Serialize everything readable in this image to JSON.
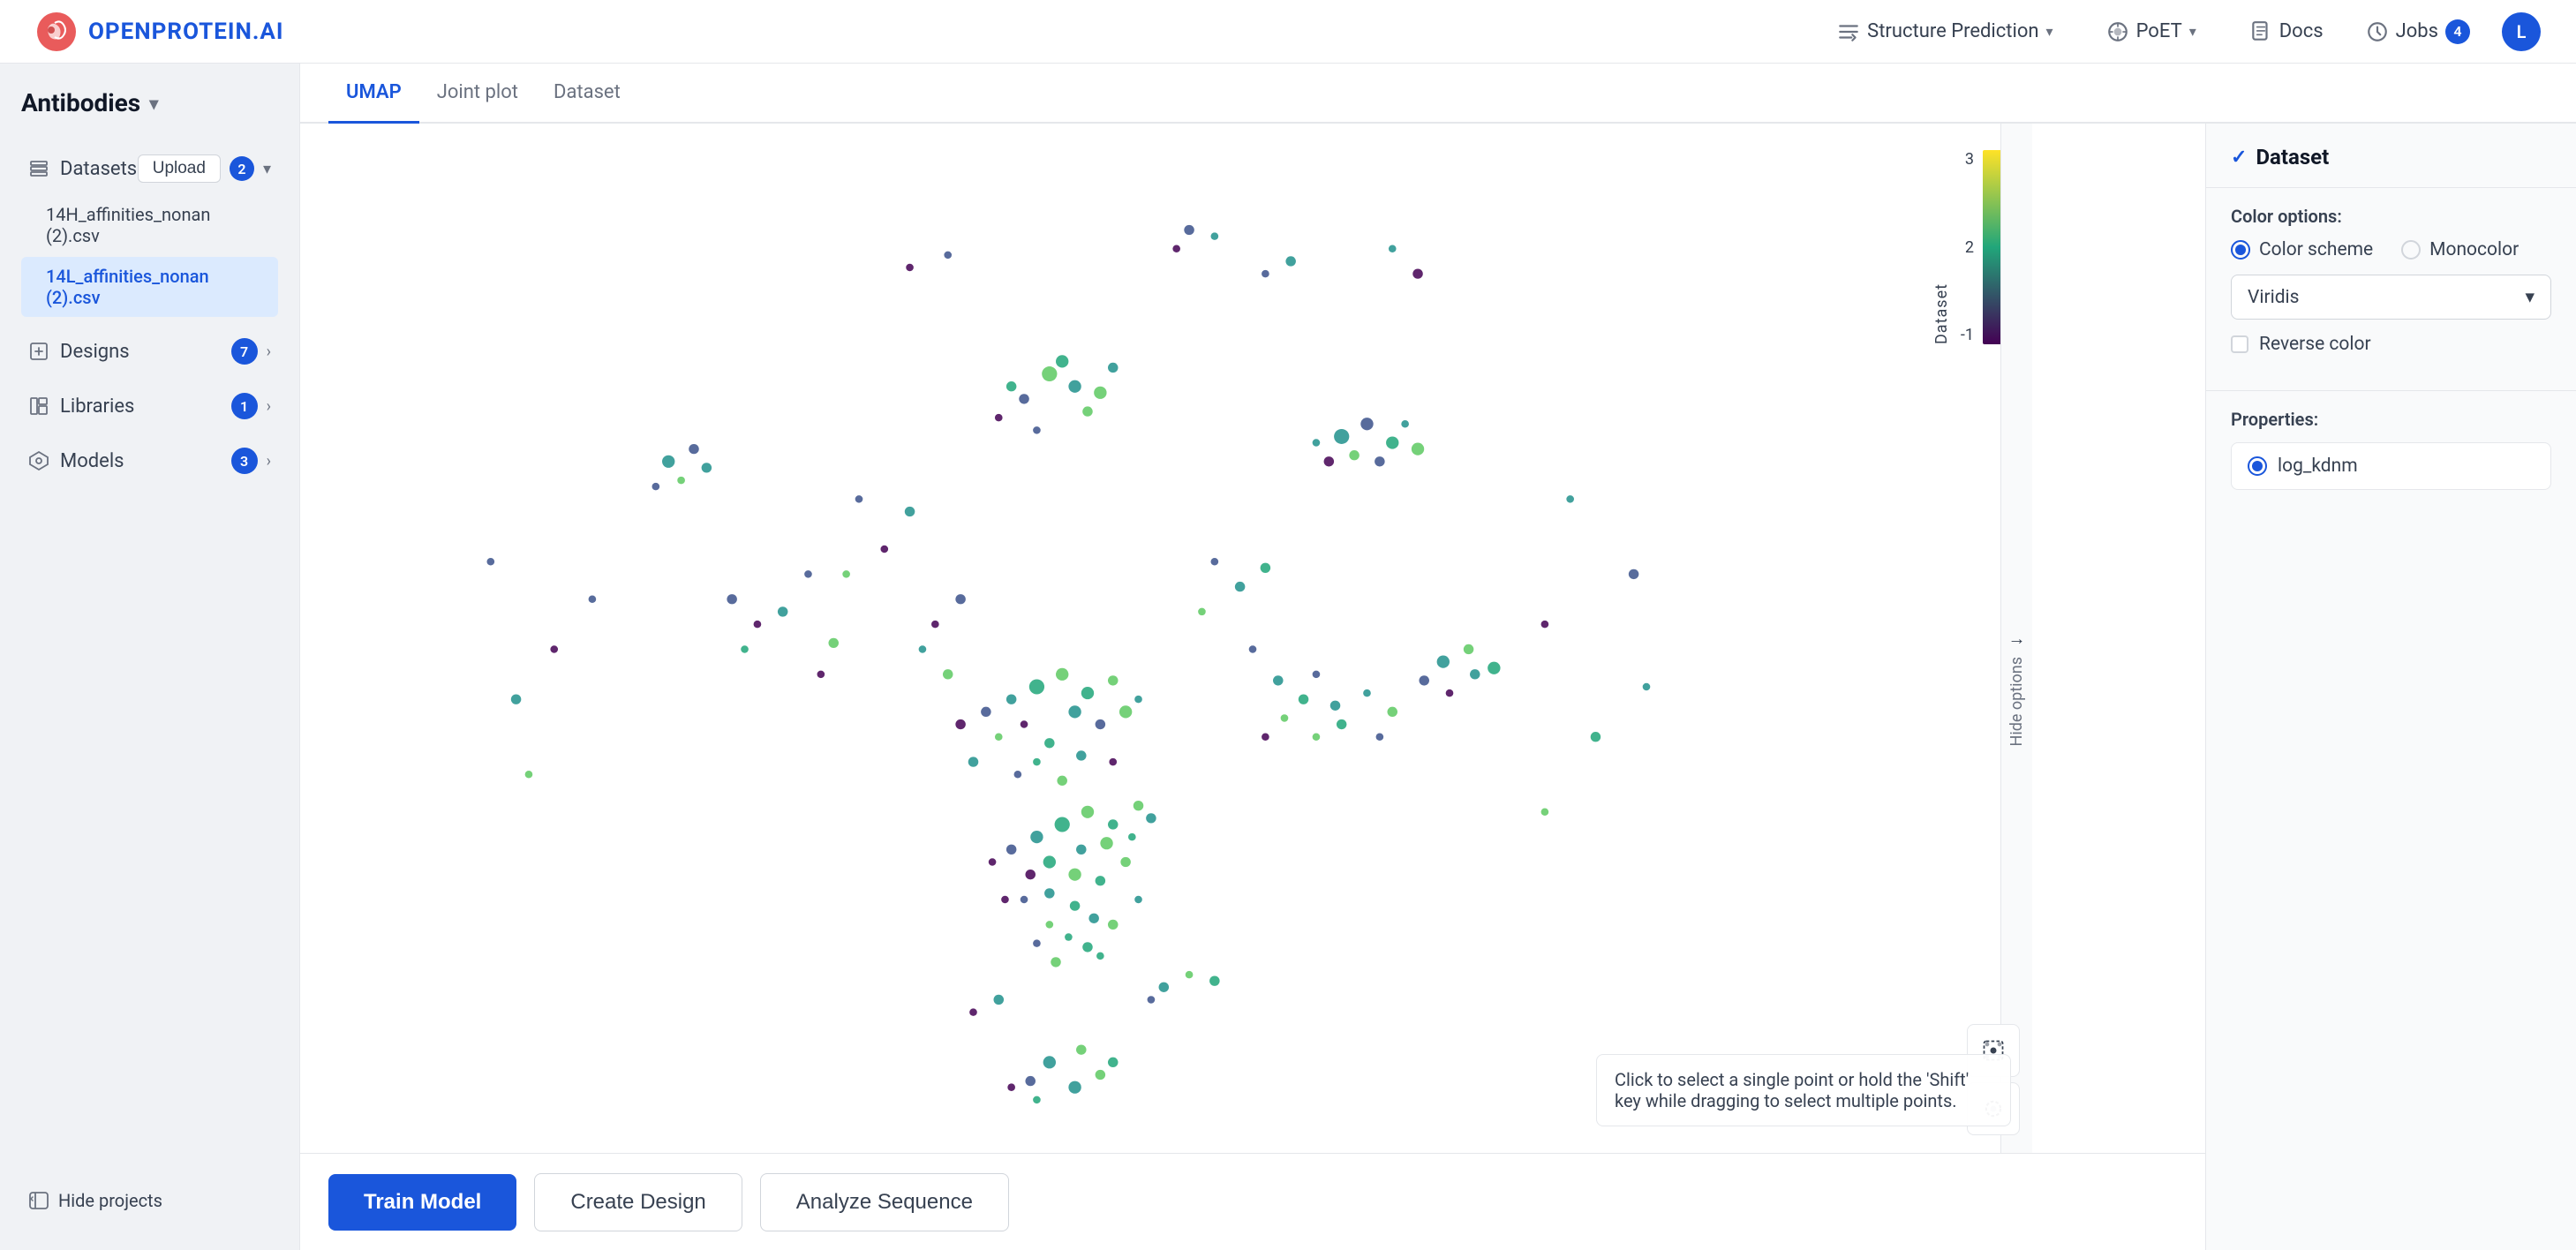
{
  "app": {
    "logo_text": "OPENPROTEIN.AI"
  },
  "topnav": {
    "structure_prediction_label": "Structure Prediction",
    "poet_label": "PoET",
    "docs_label": "Docs",
    "jobs_label": "Jobs",
    "jobs_count": "4",
    "user_initial": "L"
  },
  "sidebar": {
    "title": "Antibodies",
    "datasets_label": "Datasets",
    "upload_label": "Upload",
    "datasets_count": "2",
    "files": [
      {
        "name": "14H_affinities_nonan (2).csv",
        "active": false
      },
      {
        "name": "14L_affinities_nonan (2).csv",
        "active": true
      }
    ],
    "designs_label": "Designs",
    "designs_count": "7",
    "libraries_label": "Libraries",
    "libraries_count": "1",
    "models_label": "Models",
    "models_count": "3",
    "hide_projects_label": "Hide projects"
  },
  "tabs": [
    {
      "label": "UMAP",
      "active": true
    },
    {
      "label": "Joint plot",
      "active": false
    },
    {
      "label": "Dataset",
      "active": false
    }
  ],
  "right_panel": {
    "header_label": "Dataset",
    "color_options_label": "Color options:",
    "color_scheme_label": "Color scheme",
    "monocolor_label": "Monocolor",
    "dropdown_label": "Viridis",
    "reverse_color_label": "Reverse color",
    "properties_label": "Properties:",
    "property_value": "log_kdnm"
  },
  "colorbar": {
    "top_value": "3",
    "mid_value": "2",
    "bottom_value": "-1",
    "title": "Dataset"
  },
  "hide_options": {
    "label": "Hide options",
    "arrow": "→"
  },
  "toolbar": {
    "train_model_label": "Train Model",
    "create_design_label": "Create Design",
    "analyze_sequence_label": "Analyze Sequence"
  },
  "selection_hint": {
    "text": "Click to select a single point or hold the 'Shift' key while dragging to select multiple points."
  }
}
